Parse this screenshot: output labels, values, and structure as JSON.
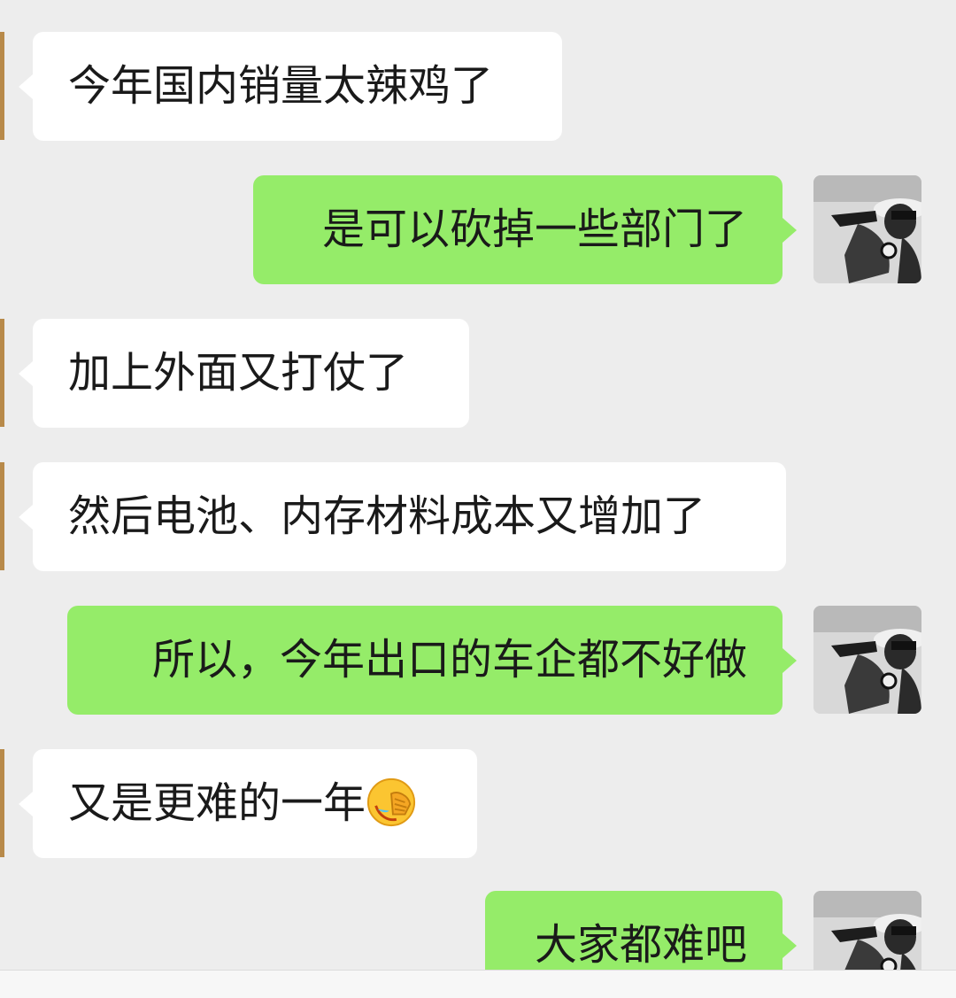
{
  "messages": [
    {
      "side": "in",
      "text": "今年国内销量太辣鸡了"
    },
    {
      "side": "out",
      "text": "是可以砍掉一些部门了"
    },
    {
      "side": "in",
      "text": "加上外面又打仗了"
    },
    {
      "side": "in",
      "text": "然后电池、内存材料成本又增加了"
    },
    {
      "side": "out",
      "text": "所以，今年出口的车企都不好做"
    },
    {
      "side": "in",
      "text": "又是更难的一年",
      "emoji": "face-palm-crying-emoji"
    },
    {
      "side": "out",
      "text": "大家都难吧"
    }
  ],
  "colors": {
    "background": "#ededed",
    "incoming_bubble": "#ffffff",
    "outgoing_bubble": "#95ec69",
    "text": "#1a1a1a"
  }
}
